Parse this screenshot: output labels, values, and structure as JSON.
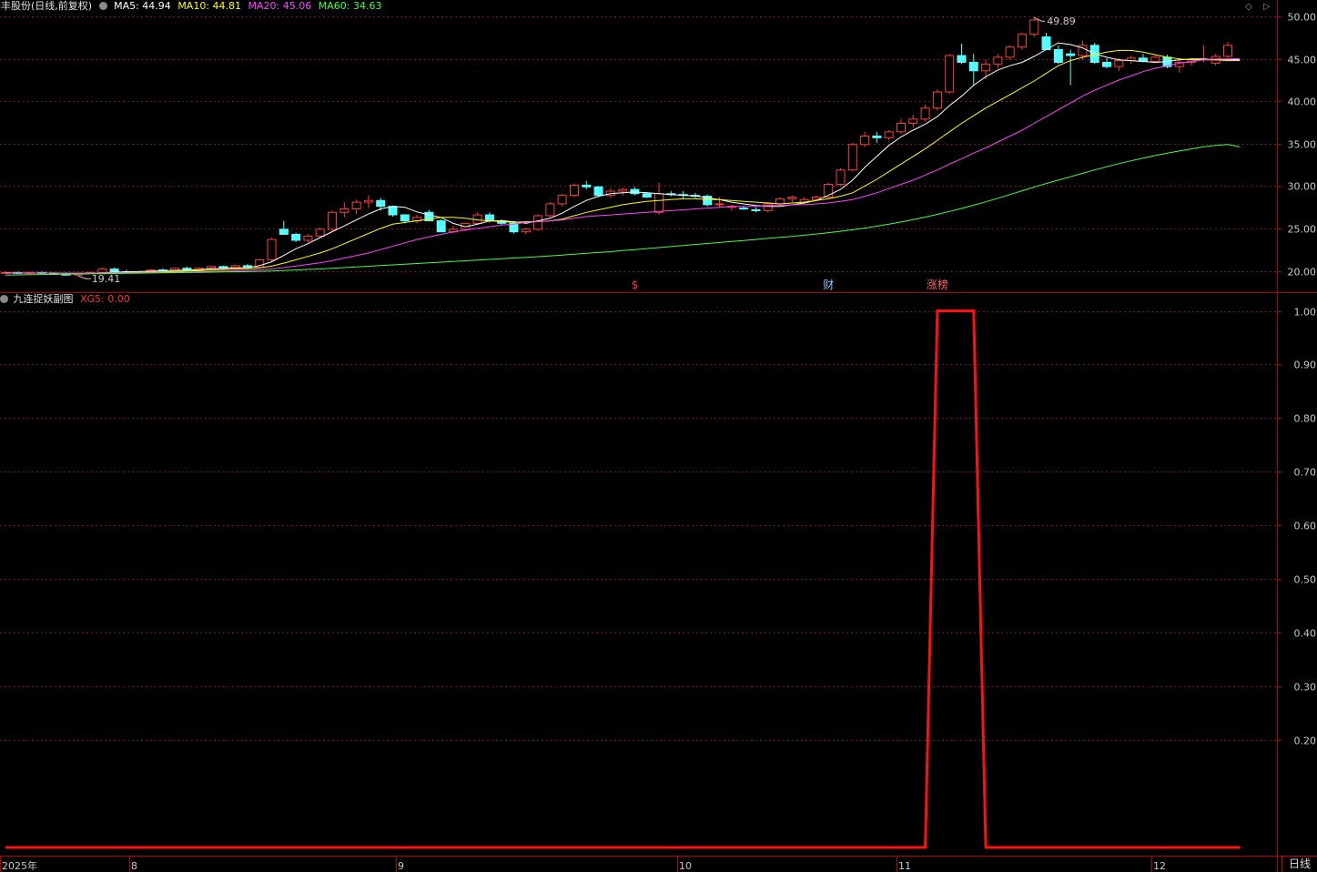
{
  "stock": {
    "name": "华丰股份(日线,前复权)"
  },
  "ma_labels": [
    {
      "text": "MA5: 44.94",
      "color": "#ffffff"
    },
    {
      "text": "MA10: 44.81",
      "color": "#ffff00"
    },
    {
      "text": "MA20: 45.06",
      "color": "#ff40ff"
    },
    {
      "text": "MA60: 34.63",
      "color": "#40ff40"
    }
  ],
  "indicator": {
    "name": "九连捉妖副图",
    "value_label": "XG5: 0.00"
  },
  "nav": {
    "prev": "◇",
    "next": "▷"
  },
  "period_button": "日线",
  "markers": [
    {
      "text": "$",
      "color": "#ff3030"
    },
    {
      "text": "财",
      "color": "#8ec8ff"
    },
    {
      "text": "涨榜",
      "color": "#ff6060"
    }
  ],
  "colors": {
    "up": "#ff3c3c",
    "down": "#54ffff",
    "grid": "#7a1818",
    "axis": "#b00000",
    "axis_text": "#c8c8c8"
  },
  "chart_data": [
    {
      "type": "candlestick",
      "ylim": [
        18.5,
        51.5
      ],
      "y_ticks": [
        "20.00",
        "25.00",
        "30.00",
        "35.00",
        "40.00",
        "45.00",
        "50.00"
      ],
      "x_labels": [
        "2025年",
        "8",
        "9",
        "10",
        "11",
        "12"
      ],
      "annotations": {
        "high": "49.89",
        "low": "19.41"
      },
      "candles": [
        [
          19.7,
          19.9,
          19.6,
          19.8
        ],
        [
          19.8,
          19.9,
          19.6,
          19.7
        ],
        [
          19.7,
          19.9,
          19.5,
          19.8
        ],
        [
          19.8,
          19.9,
          19.6,
          19.7
        ],
        [
          19.7,
          19.8,
          19.5,
          19.6
        ],
        [
          19.6,
          19.8,
          19.41,
          19.5
        ],
        [
          19.5,
          19.8,
          19.4,
          19.7
        ],
        [
          19.7,
          19.9,
          19.6,
          19.8
        ],
        [
          19.8,
          20.4,
          19.7,
          20.2
        ],
        [
          20.2,
          20.4,
          19.8,
          19.9
        ],
        [
          19.9,
          20.1,
          19.7,
          19.8
        ],
        [
          19.8,
          20.0,
          19.6,
          19.9
        ],
        [
          19.9,
          20.2,
          19.8,
          20.1
        ],
        [
          20.1,
          20.3,
          19.9,
          20.0
        ],
        [
          20.0,
          20.4,
          19.9,
          20.3
        ],
        [
          20.3,
          20.5,
          20.0,
          20.1
        ],
        [
          20.1,
          20.4,
          19.9,
          20.3
        ],
        [
          20.3,
          20.6,
          20.1,
          20.5
        ],
        [
          20.5,
          20.6,
          20.2,
          20.3
        ],
        [
          20.3,
          20.7,
          20.2,
          20.6
        ],
        [
          20.6,
          20.8,
          20.3,
          20.4
        ],
        [
          20.4,
          21.4,
          20.3,
          21.3
        ],
        [
          21.3,
          23.9,
          21.1,
          23.7
        ],
        [
          24.9,
          25.9,
          24.5,
          24.3
        ],
        [
          24.3,
          24.5,
          23.4,
          23.6
        ],
        [
          23.6,
          24.3,
          23.3,
          24.1
        ],
        [
          24.1,
          25.1,
          23.9,
          24.9
        ],
        [
          24.9,
          27.1,
          24.7,
          26.9
        ],
        [
          26.9,
          28.1,
          26.3,
          27.3
        ],
        [
          27.3,
          28.4,
          26.7,
          28.1
        ],
        [
          28.1,
          28.9,
          27.4,
          28.3
        ],
        [
          28.3,
          28.6,
          27.1,
          27.6
        ],
        [
          27.6,
          27.7,
          26.4,
          26.6
        ],
        [
          26.6,
          26.7,
          25.6,
          25.9
        ],
        [
          25.9,
          26.6,
          25.6,
          26.3
        ],
        [
          26.9,
          27.2,
          26.3,
          25.9
        ],
        [
          25.9,
          26.1,
          24.6,
          24.6
        ],
        [
          24.6,
          25.3,
          24.4,
          24.9
        ],
        [
          24.9,
          25.7,
          24.7,
          25.6
        ],
        [
          25.6,
          26.9,
          25.4,
          26.6
        ],
        [
          26.6,
          26.9,
          25.7,
          25.9
        ],
        [
          25.9,
          26.1,
          25.4,
          25.6
        ],
        [
          25.6,
          25.7,
          24.4,
          24.6
        ],
        [
          24.6,
          25.1,
          24.3,
          24.9
        ],
        [
          24.9,
          26.7,
          24.7,
          26.5
        ],
        [
          26.5,
          28.1,
          26.3,
          27.9
        ],
        [
          27.9,
          29.1,
          27.6,
          28.9
        ],
        [
          28.9,
          30.3,
          28.7,
          30.1
        ],
        [
          30.1,
          30.6,
          29.6,
          29.9
        ],
        [
          29.9,
          30.0,
          28.7,
          28.9
        ],
        [
          28.9,
          29.7,
          28.6,
          29.4
        ],
        [
          29.4,
          29.8,
          28.9,
          29.6
        ],
        [
          29.6,
          29.9,
          28.9,
          29.1
        ],
        [
          29.1,
          29.3,
          28.6,
          28.7
        ],
        [
          26.9,
          30.4,
          26.6,
          29.1
        ],
        [
          29.1,
          29.4,
          28.8,
          29.0
        ],
        [
          29.0,
          29.4,
          28.5,
          28.9
        ],
        [
          28.9,
          29.2,
          28.6,
          28.8
        ],
        [
          28.8,
          29.0,
          27.6,
          27.8
        ],
        [
          27.8,
          28.7,
          27.4,
          27.9
        ],
        [
          27.5,
          27.8,
          27.1,
          27.6
        ],
        [
          27.4,
          27.6,
          27.2,
          27.3
        ],
        [
          27.2,
          27.5,
          26.9,
          27.1
        ],
        [
          27.1,
          28.1,
          26.9,
          27.9
        ],
        [
          27.9,
          28.7,
          27.7,
          28.5
        ],
        [
          28.5,
          28.9,
          28.1,
          28.7
        ],
        [
          28.1,
          28.7,
          27.9,
          28.4
        ],
        [
          28.4,
          28.9,
          28.2,
          28.7
        ],
        [
          28.7,
          30.4,
          28.6,
          30.2
        ],
        [
          30.2,
          32.1,
          30.0,
          31.9
        ],
        [
          31.9,
          35.1,
          31.7,
          34.9
        ],
        [
          34.9,
          36.4,
          34.6,
          35.9
        ],
        [
          35.9,
          36.4,
          35.1,
          35.7
        ],
        [
          35.7,
          36.6,
          35.4,
          36.4
        ],
        [
          36.4,
          37.9,
          36.1,
          37.4
        ],
        [
          37.4,
          38.4,
          36.9,
          37.9
        ],
        [
          37.9,
          39.6,
          37.6,
          39.2
        ],
        [
          39.2,
          41.4,
          38.9,
          41.1
        ],
        [
          41.1,
          45.6,
          40.9,
          45.4
        ],
        [
          45.4,
          46.8,
          44.4,
          44.6
        ],
        [
          44.6,
          45.6,
          41.9,
          43.6
        ],
        [
          43.6,
          44.9,
          42.6,
          44.4
        ],
        [
          44.4,
          45.6,
          43.9,
          45.2
        ],
        [
          45.2,
          46.6,
          44.9,
          46.4
        ],
        [
          46.4,
          48.1,
          46.1,
          47.9
        ],
        [
          47.9,
          49.89,
          47.6,
          49.6
        ],
        [
          47.6,
          48.1,
          46.4,
          46.1
        ],
        [
          46.1,
          46.6,
          44.4,
          44.6
        ],
        [
          45.6,
          46.1,
          41.9,
          45.4
        ],
        [
          45.4,
          47.1,
          44.9,
          46.6
        ],
        [
          46.6,
          46.9,
          44.4,
          44.6
        ],
        [
          44.6,
          45.1,
          43.9,
          44.1
        ],
        [
          44.1,
          45.1,
          43.6,
          44.8
        ],
        [
          44.8,
          45.4,
          44.4,
          45.1
        ],
        [
          45.1,
          45.6,
          44.6,
          44.7
        ],
        [
          44.7,
          45.4,
          44.5,
          45.2
        ],
        [
          45.2,
          45.5,
          43.9,
          44.1
        ],
        [
          44.1,
          45.1,
          43.4,
          44.6
        ],
        [
          44.6,
          45.1,
          44.2,
          44.9
        ],
        [
          44.9,
          46.6,
          44.6,
          45.0
        ],
        [
          44.5,
          45.6,
          44.2,
          45.3
        ],
        [
          45.3,
          47.0,
          45.1,
          46.6
        ]
      ],
      "series": [
        {
          "name": "MA5",
          "values": [
            19.75,
            19.74,
            19.73,
            19.73,
            19.74,
            19.7,
            19.68,
            19.7,
            19.75,
            19.84,
            19.88,
            19.9,
            19.96,
            20.0,
            20.06,
            20.08,
            20.14,
            20.24,
            20.3,
            20.36,
            20.38,
            20.6,
            21.06,
            21.82,
            22.6,
            23.2,
            23.92,
            24.62,
            25.3,
            26.0,
            26.7,
            27.3,
            27.6,
            27.5,
            26.95,
            26.6,
            26.3,
            25.6,
            25.2,
            25.5,
            25.9,
            25.9,
            25.8,
            25.6,
            25.9,
            26.2,
            26.8,
            27.6,
            28.3,
            28.8,
            29.1,
            29.2,
            29.3,
            29.2,
            29.1,
            29.0,
            28.9,
            28.85,
            28.6,
            28.4,
            28.1,
            27.9,
            27.7,
            27.6,
            27.6,
            27.8,
            28.0,
            28.3,
            28.9,
            29.6,
            30.7,
            32.2,
            33.5,
            34.8,
            35.8,
            36.6,
            37.3,
            38.2,
            39.5,
            40.6,
            41.9,
            42.9,
            43.7,
            44.2,
            44.6,
            45.3,
            46.1,
            46.9,
            46.7,
            46.3,
            45.6,
            45.2,
            44.9,
            44.8,
            44.7,
            44.6,
            44.7,
            44.9,
            45.0,
            45.0,
            44.9,
            44.9,
            44.94
          ]
        },
        {
          "name": "MA10",
          "values": [
            19.74,
            19.74,
            19.73,
            19.73,
            19.73,
            19.72,
            19.72,
            19.72,
            19.74,
            19.77,
            19.79,
            19.8,
            19.83,
            19.87,
            19.93,
            19.97,
            20.01,
            20.08,
            20.15,
            20.2,
            20.24,
            20.35,
            20.55,
            20.9,
            21.3,
            21.7,
            22.1,
            22.6,
            23.2,
            23.8,
            24.4,
            25.0,
            25.5,
            25.7,
            25.9,
            26.1,
            26.3,
            26.3,
            26.2,
            26.0,
            25.9,
            25.8,
            25.7,
            25.8,
            25.8,
            25.9,
            26.1,
            26.5,
            26.9,
            27.2,
            27.5,
            27.8,
            28.0,
            28.2,
            28.3,
            28.4,
            28.5,
            28.5,
            28.4,
            28.4,
            28.3,
            28.2,
            28.1,
            28.0,
            27.9,
            28.0,
            28.1,
            28.3,
            28.5,
            28.8,
            29.2,
            30.0,
            30.8,
            31.7,
            32.6,
            33.5,
            34.4,
            35.4,
            36.4,
            37.4,
            38.3,
            39.2,
            40.0,
            40.8,
            41.6,
            42.4,
            43.3,
            44.2,
            44.8,
            45.2,
            45.5,
            45.8,
            46.0,
            46.0,
            45.8,
            45.5,
            45.2,
            45.0,
            44.9,
            44.9,
            44.9,
            44.8,
            44.81
          ]
        },
        {
          "name": "MA20",
          "values": [
            19.74,
            19.74,
            19.74,
            19.74,
            19.74,
            19.73,
            19.73,
            19.73,
            19.74,
            19.75,
            19.76,
            19.77,
            19.78,
            19.8,
            19.82,
            19.85,
            19.88,
            19.92,
            19.96,
            20.0,
            20.05,
            20.12,
            20.22,
            20.38,
            20.56,
            20.75,
            20.95,
            21.2,
            21.5,
            21.8,
            22.1,
            22.5,
            22.9,
            23.3,
            23.7,
            24.0,
            24.3,
            24.6,
            24.8,
            25.0,
            25.2,
            25.4,
            25.5,
            25.7,
            25.8,
            25.9,
            26.0,
            26.2,
            26.4,
            26.5,
            26.6,
            26.7,
            26.8,
            26.9,
            27.0,
            27.1,
            27.2,
            27.3,
            27.4,
            27.5,
            27.6,
            27.6,
            27.6,
            27.7,
            27.7,
            27.8,
            27.8,
            27.9,
            28.0,
            28.2,
            28.4,
            28.8,
            29.2,
            29.7,
            30.2,
            30.7,
            31.3,
            31.9,
            32.6,
            33.2,
            33.9,
            34.5,
            35.2,
            35.9,
            36.6,
            37.4,
            38.2,
            39.0,
            39.8,
            40.6,
            41.3,
            41.9,
            42.5,
            43.0,
            43.5,
            43.9,
            44.2,
            44.5,
            44.7,
            44.9,
            45.0,
            45.0,
            45.06
          ]
        },
        {
          "name": "MA60",
          "values": [
            19.5,
            19.52,
            19.54,
            19.56,
            19.58,
            19.6,
            19.62,
            19.64,
            19.66,
            19.68,
            19.7,
            19.72,
            19.74,
            19.76,
            19.78,
            19.8,
            19.82,
            19.84,
            19.86,
            19.88,
            19.9,
            19.94,
            19.98,
            20.04,
            20.1,
            20.16,
            20.22,
            20.3,
            20.38,
            20.46,
            20.54,
            20.62,
            20.7,
            20.78,
            20.86,
            20.94,
            21.02,
            21.1,
            21.18,
            21.26,
            21.34,
            21.42,
            21.5,
            21.58,
            21.66,
            21.76,
            21.86,
            21.96,
            22.06,
            22.16,
            22.26,
            22.38,
            22.5,
            22.62,
            22.74,
            22.86,
            22.98,
            23.1,
            23.22,
            23.34,
            23.46,
            23.58,
            23.7,
            23.82,
            23.94,
            24.06,
            24.2,
            24.34,
            24.5,
            24.66,
            24.84,
            25.04,
            25.26,
            25.5,
            25.76,
            26.04,
            26.34,
            26.66,
            27.0,
            27.36,
            27.74,
            28.14,
            28.56,
            29.0,
            29.44,
            29.88,
            30.3,
            30.7,
            31.1,
            31.5,
            31.9,
            32.28,
            32.64,
            32.98,
            33.3,
            33.6,
            33.88,
            34.14,
            34.38,
            34.63,
            34.8,
            34.9,
            34.63
          ]
        }
      ]
    },
    {
      "type": "line",
      "ylim": [
        -0.15,
        1.0
      ],
      "y_ticks": [
        "0.20",
        "0.30",
        "0.40",
        "0.50",
        "0.60",
        "0.70",
        "0.80",
        "0.90",
        "1.00"
      ],
      "series": [
        {
          "name": "XG5",
          "values": [
            0,
            0,
            0,
            0,
            0,
            0,
            0,
            0,
            0,
            0,
            0,
            0,
            0,
            0,
            0,
            0,
            0,
            0,
            0,
            0,
            0,
            0,
            0,
            0,
            0,
            0,
            0,
            0,
            0,
            0,
            0,
            0,
            0,
            0,
            0,
            0,
            0,
            0,
            0,
            0,
            0,
            0,
            0,
            0,
            0,
            0,
            0,
            0,
            0,
            0,
            0,
            0,
            0,
            0,
            0,
            0,
            0,
            0,
            0,
            0,
            0,
            0,
            0,
            0,
            0,
            0,
            0,
            0,
            0,
            0,
            0,
            0,
            0,
            0,
            0,
            0,
            0,
            1,
            1,
            1,
            1,
            0,
            0,
            0,
            0,
            0,
            0,
            0,
            0,
            0,
            0,
            0,
            0,
            0,
            0,
            0,
            0,
            0,
            0,
            0,
            0,
            0,
            0
          ]
        }
      ]
    }
  ]
}
